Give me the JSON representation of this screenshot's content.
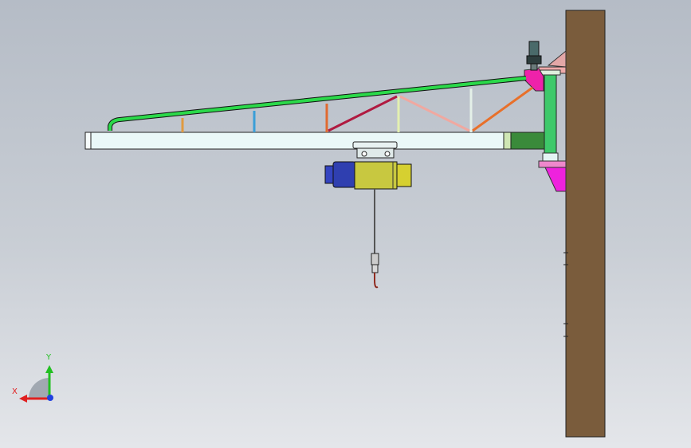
{
  "viewport": {
    "background_top": "#b5bcc6",
    "background_bottom": "#e4e6ea"
  },
  "model": {
    "wall_color": "#7a5c3c",
    "main_beam_color": "#eaf8f8",
    "top_chord_color": "#2bd94a",
    "hoist_body_color": "#c8c840",
    "hoist_motor_color": "#2f3fb0",
    "bracket_color": "#ee22dd",
    "mast_color": "#3ec96a",
    "end_block_color": "#3a8a3a",
    "icons": [
      "wall-column",
      "jib-arm",
      "truss",
      "slewing-mast",
      "wall-bracket",
      "drive-motor",
      "trolley",
      "electric-hoist",
      "wire-rope",
      "hook-block"
    ]
  },
  "triad": {
    "x_label": "X",
    "y_label": "Y",
    "x_color": "#e02020",
    "y_color": "#22c022",
    "z_color": "#2040e0"
  }
}
